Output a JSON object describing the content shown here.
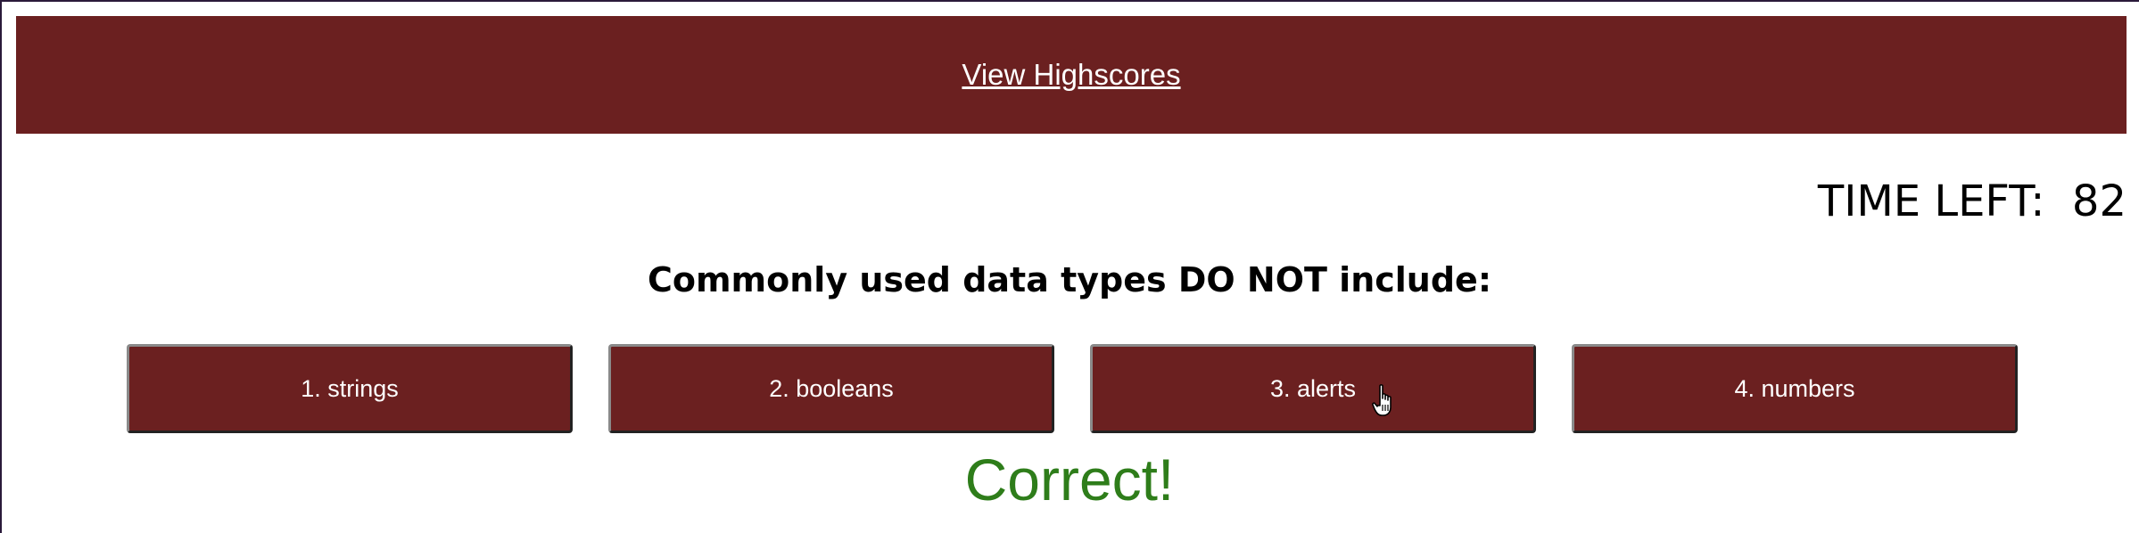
{
  "header": {
    "highscores_link": "View Highscores",
    "background_color": "#6b2020"
  },
  "timer": {
    "label": "TIME LEFT:",
    "value": "82"
  },
  "question": {
    "text": "Commonly used data types DO NOT include:"
  },
  "answers": [
    {
      "label": "1. strings"
    },
    {
      "label": "2. booleans"
    },
    {
      "label": "3. alerts"
    },
    {
      "label": "4. numbers"
    }
  ],
  "feedback": {
    "text": "Correct!",
    "color": "#2e7d1a"
  },
  "cursor": {
    "icon": "hand-pointer-icon"
  }
}
